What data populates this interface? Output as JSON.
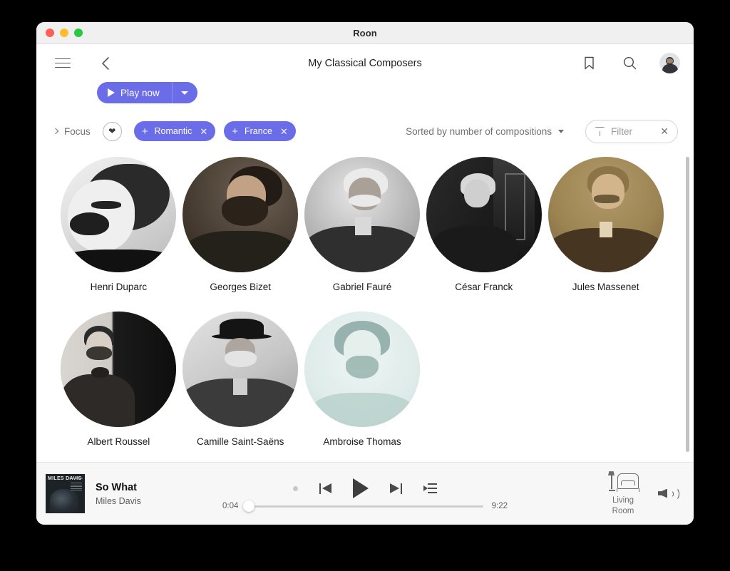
{
  "window": {
    "title": "Roon",
    "traffic_lights": [
      "close-red",
      "minimize-yellow",
      "zoom-green"
    ]
  },
  "header": {
    "menu_icon": "hamburger-icon",
    "back_icon": "chevron-left-icon",
    "title": "My Classical Composers",
    "bookmark_icon": "bookmark-icon",
    "search_icon": "search-icon",
    "avatar": "user-avatar"
  },
  "actions": {
    "play_now_label": "Play now",
    "play_icon": "play-triangle-icon",
    "dropdown_icon": "chevron-down-icon",
    "accent_color": "#6b6ce8"
  },
  "focus_bar": {
    "focus_label": "Focus",
    "focus_chevron": "chevron-right-icon",
    "favorite_icon": "heart-icon",
    "chips": [
      {
        "label": "Romantic",
        "add_icon": "plus-icon",
        "remove_icon": "close-icon"
      },
      {
        "label": "France",
        "add_icon": "plus-icon",
        "remove_icon": "close-icon"
      }
    ],
    "sort_label": "Sorted by number of compositions",
    "sort_caret": "caret-down-icon",
    "filter_icon": "funnel-icon",
    "filter_placeholder": "Filter",
    "filter_value": "",
    "filter_clear_icon": "close-icon"
  },
  "composers": [
    {
      "name": "Henri Duparc",
      "tone": "bw-high-contrast"
    },
    {
      "name": "Georges Bizet",
      "tone": "sepia-dark"
    },
    {
      "name": "Gabriel Fauré",
      "tone": "grayscale"
    },
    {
      "name": "César Franck",
      "tone": "bw-engraving-dark"
    },
    {
      "name": "Jules Massenet",
      "tone": "sepia-warm"
    },
    {
      "name": "Albert Roussel",
      "tone": "bw-orange-edge"
    },
    {
      "name": "Camille Saint-Saëns",
      "tone": "grayscale"
    },
    {
      "name": "Ambroise Thomas",
      "tone": "teal-sketch"
    }
  ],
  "player": {
    "album_art_text": "MILES DAVIS",
    "album_art_subtitle": "Kind of Blue",
    "track_title": "So What",
    "artist": "Miles Davis",
    "controls": {
      "shuffle_icon": "shuffle-dot-icon",
      "previous_icon": "previous-track-icon",
      "play_icon": "play-triangle-icon",
      "next_icon": "next-track-icon",
      "queue_icon": "queue-list-icon"
    },
    "elapsed": "0:04",
    "duration": "9:22",
    "progress_percent": 0.7,
    "zone": {
      "icon": "lamp-armchair-icon",
      "name_line1": "Living",
      "name_line2": "Room",
      "volume_icon": "speaker-volume-icon"
    }
  }
}
